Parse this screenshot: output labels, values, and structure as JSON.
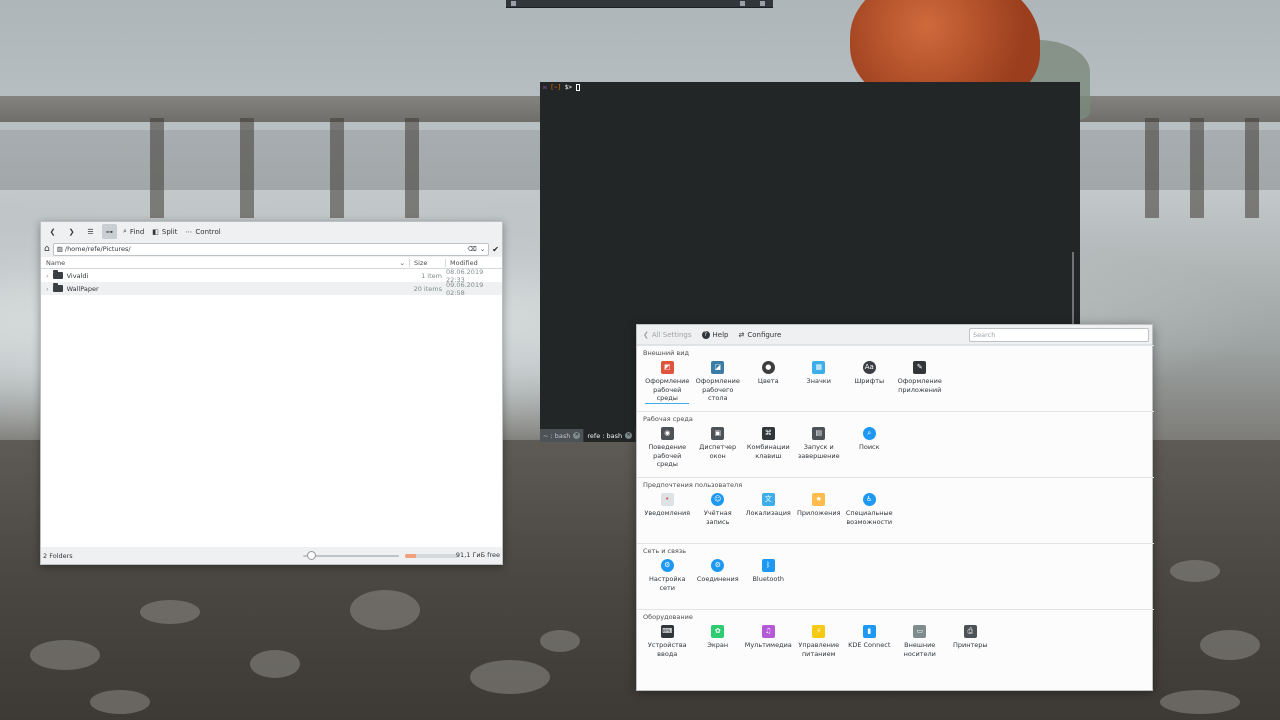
{
  "desktop": {
    "wallpaper": "beach-pier-photo"
  },
  "dolphin": {
    "toolbar": {
      "find": "Find",
      "split": "Split",
      "control": "Control"
    },
    "location": "/home/refe/Pictures/",
    "columns": {
      "name": "Name",
      "size": "Size",
      "modified": "Modified"
    },
    "rows": [
      {
        "name": "Vivaldi",
        "size": "1 item",
        "modified": "08.06.2019 22:33"
      },
      {
        "name": "WallPaper",
        "size": "20 items",
        "modified": "09.06.2019 02:58"
      }
    ],
    "status": {
      "folders": "2 Folders",
      "free": "91,1 ГиБ free",
      "used_fraction": 0.2
    }
  },
  "konsole": {
    "prompt": {
      "user": "✉",
      "dir": "[~]",
      "sign": "$>"
    },
    "tabs": [
      {
        "label": "~ : bash",
        "active": false
      },
      {
        "label": "refe : bash",
        "active": true
      }
    ]
  },
  "settings": {
    "toolbar": {
      "all_settings": "All Settings",
      "help": "Help",
      "configure": "Configure"
    },
    "search_placeholder": "Search",
    "sections": [
      {
        "title": "Внешний вид",
        "items": [
          {
            "label": "Оформление\nрабочей\nсреды",
            "icon": "workspace-theme-icon",
            "glyph": "◩",
            "color": "#e0533d"
          },
          {
            "label": "Оформление\nрабочего\nстола",
            "icon": "desktop-theme-icon",
            "glyph": "◪",
            "color": "#3a7ca5"
          },
          {
            "label": "Цвета",
            "icon": "colors-icon",
            "glyph": "●",
            "color": "#3d3d3d"
          },
          {
            "label": "Значки",
            "icon": "icons-icon",
            "glyph": "▦",
            "color": "#3daee9"
          },
          {
            "label": "Шрифты",
            "icon": "fonts-icon",
            "glyph": "Aa",
            "color": "#3b3f44"
          },
          {
            "label": "Оформление\nприложений",
            "icon": "app-style-icon",
            "glyph": "✎",
            "color": "#31363b"
          }
        ]
      },
      {
        "title": "Рабочая среда",
        "items": [
          {
            "label": "Поведение\nрабочей\nсреды",
            "icon": "workspace-behavior-icon",
            "glyph": "◉",
            "color": "#4d5257"
          },
          {
            "label": "Диспетчер\nокон",
            "icon": "window-manager-icon",
            "glyph": "▣",
            "color": "#4d5257"
          },
          {
            "label": "Комбинации\nклавиш",
            "icon": "shortcuts-icon",
            "glyph": "⌘",
            "color": "#31363b"
          },
          {
            "label": "Запуск и\nзавершение",
            "icon": "startup-icon",
            "glyph": "▤",
            "color": "#4d5257"
          },
          {
            "label": "Поиск",
            "icon": "search-icon",
            "glyph": "⌕",
            "color": "#1d99f3"
          }
        ]
      },
      {
        "title": "Предпочтения пользователя",
        "items": [
          {
            "label": "Уведомления",
            "icon": "notifications-icon",
            "glyph": "•",
            "color": "#dfe2e4"
          },
          {
            "label": "Учётная\nзапись",
            "icon": "account-icon",
            "glyph": "☺",
            "color": "#1d99f3"
          },
          {
            "label": "Локализация",
            "icon": "localization-icon",
            "glyph": "文",
            "color": "#3daee9"
          },
          {
            "label": "Приложения",
            "icon": "applications-icon",
            "glyph": "★",
            "color": "#fdbc4b"
          },
          {
            "label": "Специальные\nвозможности",
            "icon": "accessibility-icon",
            "glyph": "♿",
            "color": "#1d99f3"
          }
        ]
      },
      {
        "title": "Сеть и связь",
        "items": [
          {
            "label": "Настройка\nсети",
            "icon": "network-settings-icon",
            "glyph": "⚙",
            "color": "#1d99f3"
          },
          {
            "label": "Соединения",
            "icon": "connections-icon",
            "glyph": "⚙",
            "color": "#1d99f3"
          },
          {
            "label": "Bluetooth",
            "icon": "bluetooth-icon",
            "glyph": "ᛒ",
            "color": "#1d99f3"
          }
        ]
      },
      {
        "title": "Оборудование",
        "items": [
          {
            "label": "Устройства\nввода",
            "icon": "input-devices-icon",
            "glyph": "⌨",
            "color": "#31363b"
          },
          {
            "label": "Экран",
            "icon": "display-icon",
            "glyph": "✿",
            "color": "#2ecc71"
          },
          {
            "label": "Мультимедиа",
            "icon": "multimedia-icon",
            "glyph": "♫",
            "color": "#b45ad6"
          },
          {
            "label": "Управление\nпитанием",
            "icon": "power-icon",
            "glyph": "⚡",
            "color": "#f6c915"
          },
          {
            "label": "KDE Connect",
            "icon": "kde-connect-icon",
            "glyph": "▮",
            "color": "#1d99f3"
          },
          {
            "label": "Внешние\nносители",
            "icon": "removable-storage-icon",
            "glyph": "▭",
            "color": "#7f8c8d"
          },
          {
            "label": "Принтеры",
            "icon": "printers-icon",
            "glyph": "⎙",
            "color": "#4d5257"
          }
        ]
      }
    ]
  }
}
